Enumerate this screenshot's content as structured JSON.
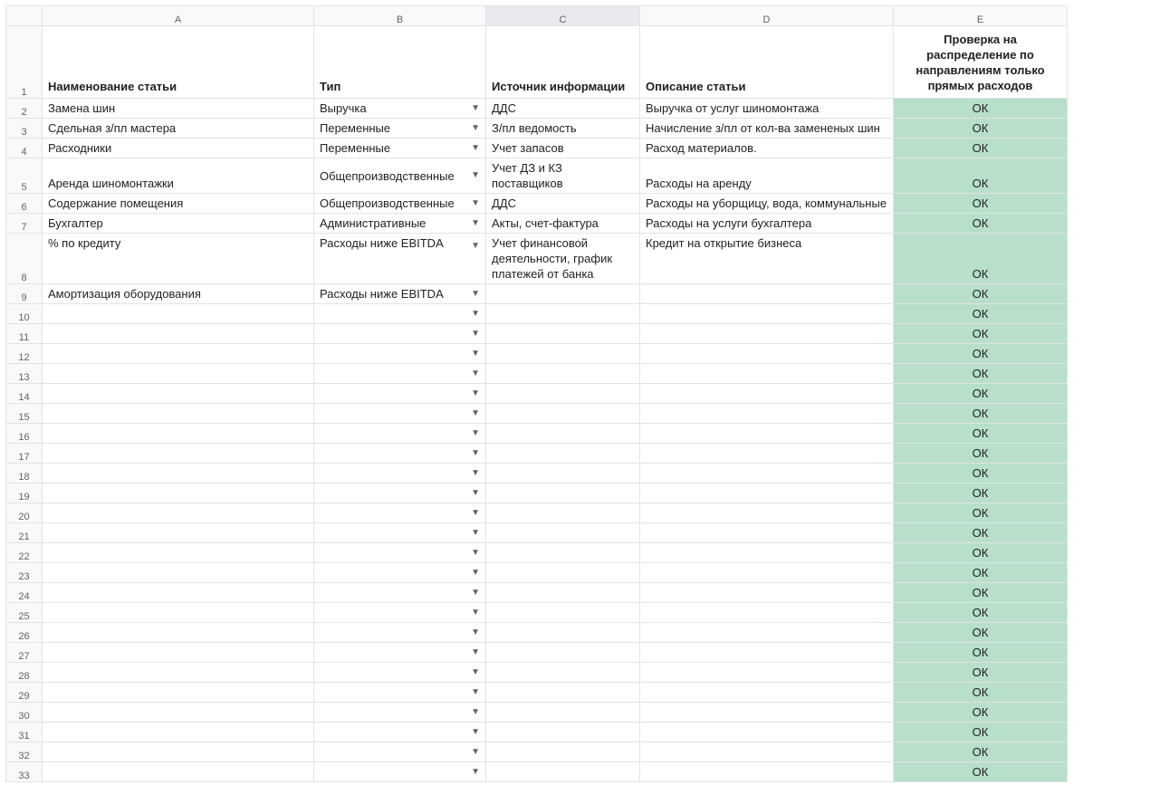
{
  "columns": [
    "A",
    "B",
    "C",
    "D",
    "E"
  ],
  "selected_column_index": 2,
  "header_row_number": "1",
  "headers": {
    "A": "Наименование статьи",
    "B": "Тип",
    "C": "Источник информации",
    "D": "Описание статьи",
    "E": "Проверка на распределение по направлениям только прямых расходов"
  },
  "dropdown_column": "B",
  "ok_value": "ОК",
  "rows": [
    {
      "n": "2",
      "cols": {
        "A": "Замена шин",
        "B": "Выручка",
        "C": "ДДС",
        "D": "Выручка от услуг шиномонтажа",
        "E": "ОК"
      }
    },
    {
      "n": "3",
      "cols": {
        "A": "Сдельная з/пл мастера",
        "B": "Переменные",
        "C": "З/пл ведомость",
        "D": "Начисление з/пл от кол-ва замененых шин",
        "E": "ОК"
      }
    },
    {
      "n": "4",
      "cols": {
        "A": "Расходники",
        "B": "Переменные",
        "C": "Учет запасов",
        "D": "Расход материалов.",
        "E": "ОК"
      }
    },
    {
      "n": "5",
      "cols": {
        "A": "Аренда шиномонтажки",
        "B": "Общепроизводственные",
        "C": "Учет ДЗ и КЗ поставщиков",
        "D": "Расходы на аренду",
        "E": "ОК"
      }
    },
    {
      "n": "6",
      "cols": {
        "A": "Содержание помещения",
        "B": "Общепроизводственные",
        "C": "ДДС",
        "D": "Расходы на уборщицу, вода, коммунальные",
        "E": "ОК"
      }
    },
    {
      "n": "7",
      "cols": {
        "A": "Бухгалтер",
        "B": "Административные",
        "C": "Акты, счет-фактура",
        "D": "Расходы на услуги бухгалтера",
        "E": "ОК"
      }
    },
    {
      "n": "8",
      "multiline": true,
      "cols": {
        "A": "% по кредиту",
        "B": "Расходы ниже EBITDA",
        "C": "Учет финансовой деятельности, график платежей от банка",
        "D": "Кредит на открытие бизнеса",
        "E": "ОК"
      }
    },
    {
      "n": "9",
      "cols": {
        "A": "Амортизация оборудования",
        "B": "Расходы ниже EBITDA",
        "C": "",
        "D": "",
        "E": "ОК"
      }
    },
    {
      "n": "10",
      "cols": {
        "A": "",
        "B": "",
        "C": "",
        "D": "",
        "E": "ОК"
      }
    },
    {
      "n": "11",
      "cols": {
        "A": "",
        "B": "",
        "C": "",
        "D": "",
        "E": "ОК"
      }
    },
    {
      "n": "12",
      "cols": {
        "A": "",
        "B": "",
        "C": "",
        "D": "",
        "E": "ОК"
      }
    },
    {
      "n": "13",
      "cols": {
        "A": "",
        "B": "",
        "C": "",
        "D": "",
        "E": "ОК"
      }
    },
    {
      "n": "14",
      "cols": {
        "A": "",
        "B": "",
        "C": "",
        "D": "",
        "E": "ОК"
      }
    },
    {
      "n": "15",
      "cols": {
        "A": "",
        "B": "",
        "C": "",
        "D": "",
        "E": "ОК"
      }
    },
    {
      "n": "16",
      "cols": {
        "A": "",
        "B": "",
        "C": "",
        "D": "",
        "E": "ОК"
      }
    },
    {
      "n": "17",
      "cols": {
        "A": "",
        "B": "",
        "C": "",
        "D": "",
        "E": "ОК"
      }
    },
    {
      "n": "18",
      "cols": {
        "A": "",
        "B": "",
        "C": "",
        "D": "",
        "E": "ОК"
      }
    },
    {
      "n": "19",
      "cols": {
        "A": "",
        "B": "",
        "C": "",
        "D": "",
        "E": "ОК"
      }
    },
    {
      "n": "20",
      "cols": {
        "A": "",
        "B": "",
        "C": "",
        "D": "",
        "E": "ОК"
      }
    },
    {
      "n": "21",
      "cols": {
        "A": "",
        "B": "",
        "C": "",
        "D": "",
        "E": "ОК"
      }
    },
    {
      "n": "22",
      "cols": {
        "A": "",
        "B": "",
        "C": "",
        "D": "",
        "E": "ОК"
      }
    },
    {
      "n": "23",
      "cols": {
        "A": "",
        "B": "",
        "C": "",
        "D": "",
        "E": "ОК"
      }
    },
    {
      "n": "24",
      "cols": {
        "A": "",
        "B": "",
        "C": "",
        "D": "",
        "E": "ОК"
      }
    },
    {
      "n": "25",
      "cols": {
        "A": "",
        "B": "",
        "C": "",
        "D": "",
        "E": "ОК"
      }
    },
    {
      "n": "26",
      "cols": {
        "A": "",
        "B": "",
        "C": "",
        "D": "",
        "E": "ОК"
      }
    },
    {
      "n": "27",
      "cols": {
        "A": "",
        "B": "",
        "C": "",
        "D": "",
        "E": "ОК"
      }
    },
    {
      "n": "28",
      "cols": {
        "A": "",
        "B": "",
        "C": "",
        "D": "",
        "E": "ОК"
      }
    },
    {
      "n": "29",
      "cols": {
        "A": "",
        "B": "",
        "C": "",
        "D": "",
        "E": "ОК"
      }
    },
    {
      "n": "30",
      "cols": {
        "A": "",
        "B": "",
        "C": "",
        "D": "",
        "E": "ОК"
      }
    },
    {
      "n": "31",
      "cols": {
        "A": "",
        "B": "",
        "C": "",
        "D": "",
        "E": "ОК"
      }
    },
    {
      "n": "32",
      "cols": {
        "A": "",
        "B": "",
        "C": "",
        "D": "",
        "E": "ОК"
      }
    },
    {
      "n": "33",
      "cols": {
        "A": "",
        "B": "",
        "C": "",
        "D": "",
        "E": "ОК"
      }
    }
  ]
}
